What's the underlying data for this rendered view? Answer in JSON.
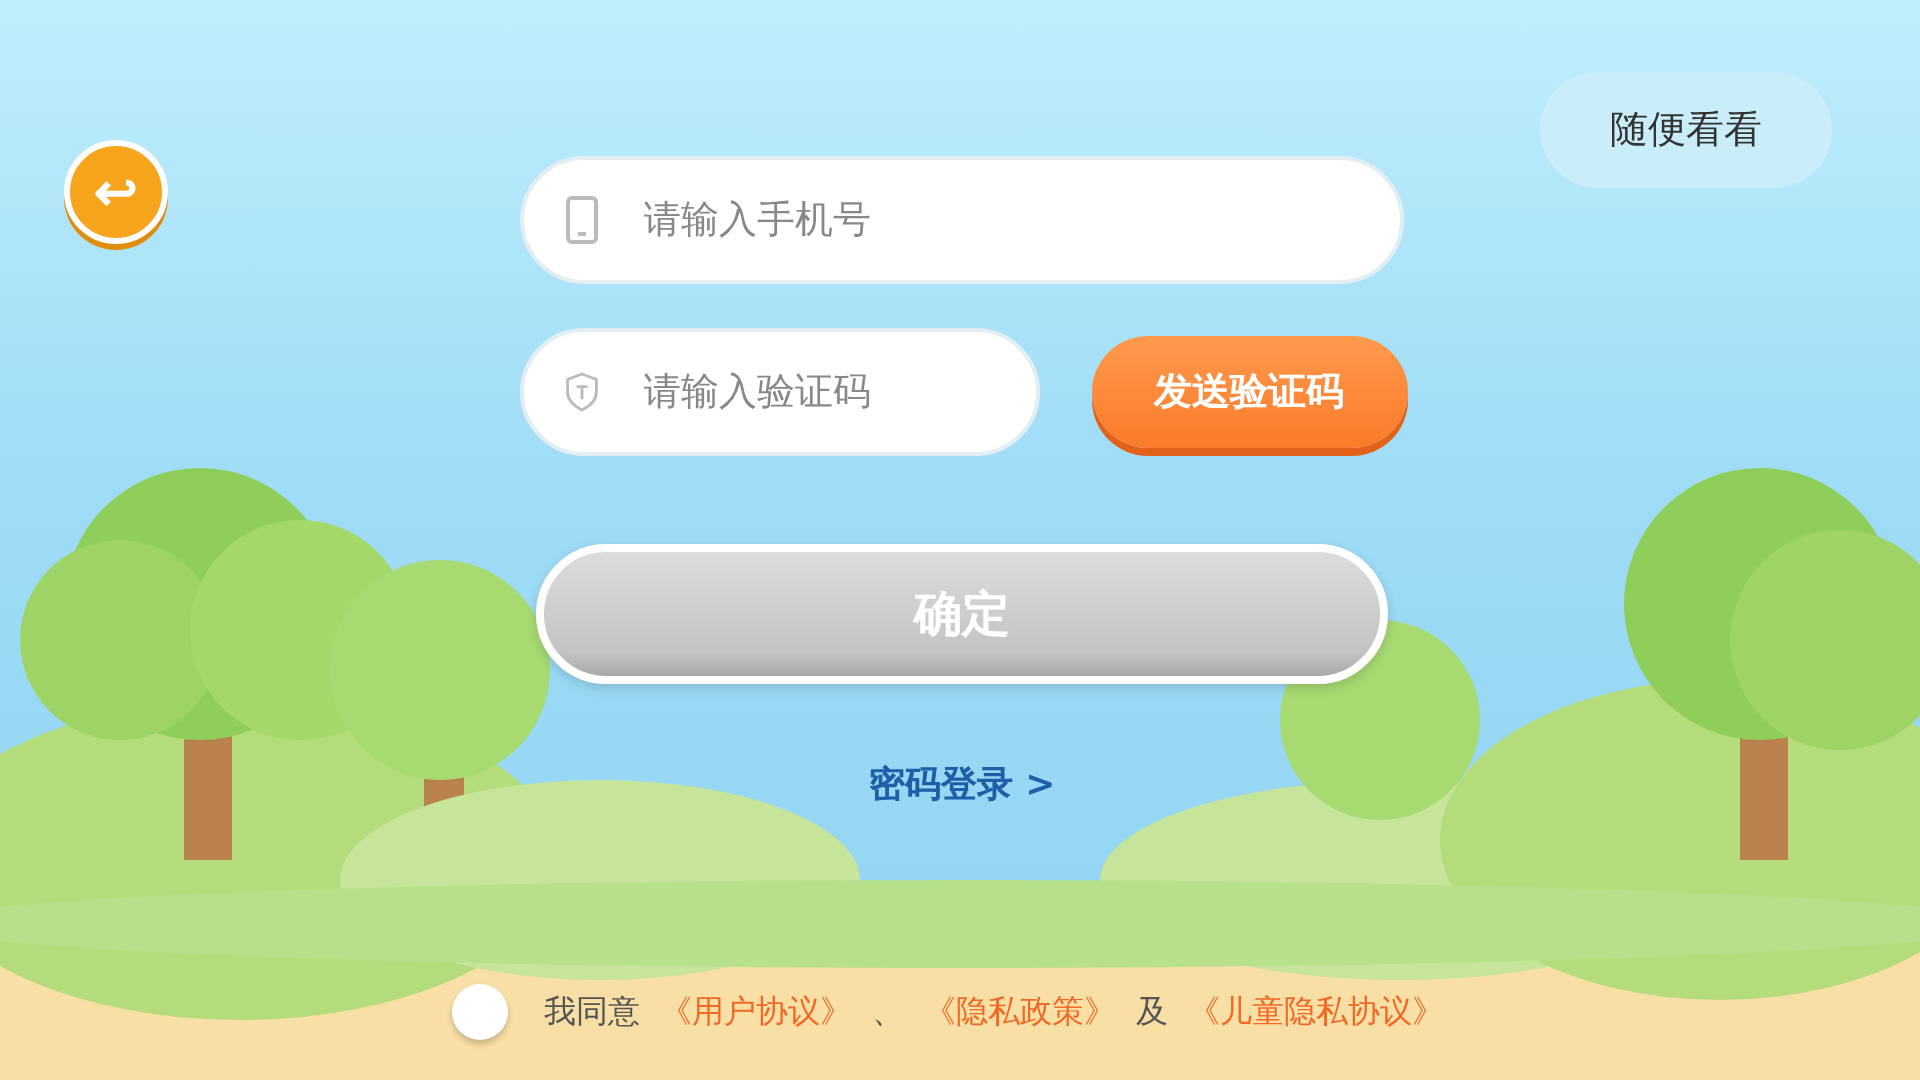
{
  "back_button": {
    "icon": "↩"
  },
  "browse_button": {
    "label": "随便看看"
  },
  "phone_field": {
    "placeholder": "请输入手机号"
  },
  "code_field": {
    "placeholder": "请输入验证码"
  },
  "send_code_button": {
    "label": "发送验证码"
  },
  "confirm_button": {
    "label": "确定",
    "disabled": true
  },
  "password_login_link": {
    "label": "密码登录 >"
  },
  "agreement": {
    "checked": false,
    "parts": [
      {
        "kind": "text",
        "text": "我同意"
      },
      {
        "kind": "link",
        "text": "《用户协议》"
      },
      {
        "kind": "text",
        "text": "、"
      },
      {
        "kind": "link",
        "text": "《隐私政策》"
      },
      {
        "kind": "text",
        "text": "及"
      },
      {
        "kind": "link",
        "text": "《儿童隐私协议》"
      }
    ]
  }
}
